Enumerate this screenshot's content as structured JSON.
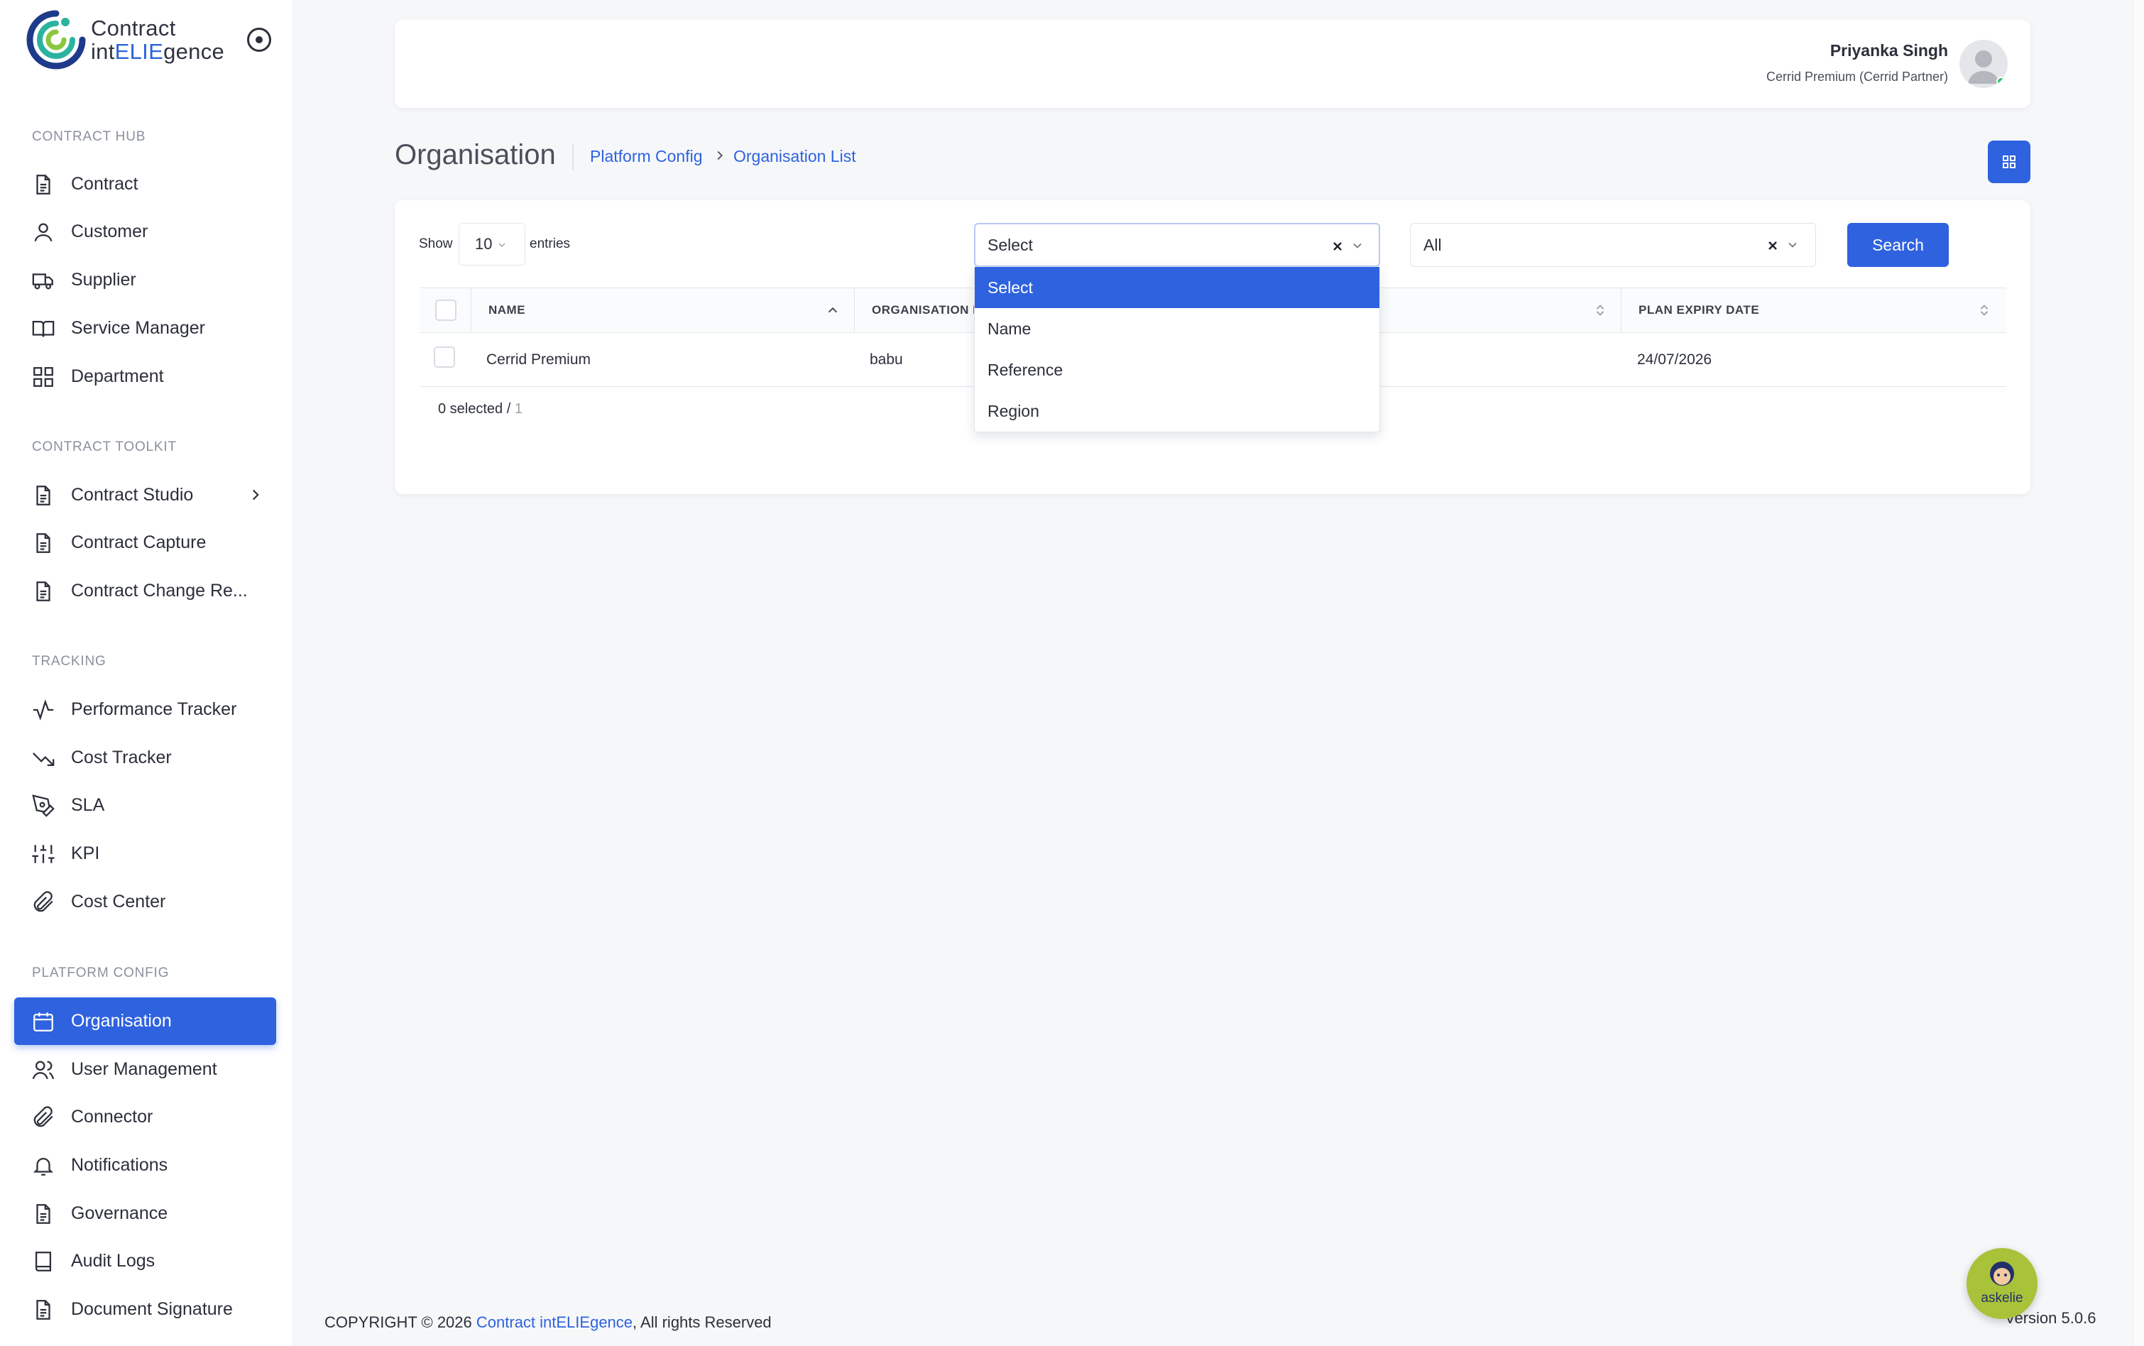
{
  "app": {
    "logo_line1": "Contract",
    "logo_line2_a": "int",
    "logo_line2_b": "ELIE",
    "logo_line2_c": "gence"
  },
  "sidebar": {
    "sections": [
      {
        "title": "CONTRACT HUB",
        "items": [
          {
            "label": "Contract",
            "icon": "file-text-icon"
          },
          {
            "label": "Customer",
            "icon": "user-icon"
          },
          {
            "label": "Supplier",
            "icon": "truck-icon"
          },
          {
            "label": "Service Manager",
            "icon": "book-open-icon"
          },
          {
            "label": "Department",
            "icon": "grid-icon"
          }
        ]
      },
      {
        "title": "CONTRACT TOOLKIT",
        "items": [
          {
            "label": "Contract Studio",
            "icon": "file-text-icon",
            "has_submenu": true
          },
          {
            "label": "Contract Capture",
            "icon": "file-text-icon"
          },
          {
            "label": "Contract Change Re...",
            "icon": "file-text-icon"
          }
        ]
      },
      {
        "title": "TRACKING",
        "items": [
          {
            "label": "Performance Tracker",
            "icon": "activity-icon"
          },
          {
            "label": "Cost Tracker",
            "icon": "trending-down-icon"
          },
          {
            "label": "SLA",
            "icon": "pen-tool-icon"
          },
          {
            "label": "KPI",
            "icon": "sliders-icon"
          },
          {
            "label": "Cost Center",
            "icon": "paperclip-icon"
          }
        ]
      },
      {
        "title": "PLATFORM CONFIG",
        "items": [
          {
            "label": "Organisation",
            "icon": "calendar-icon",
            "active": true
          },
          {
            "label": "User Management",
            "icon": "users-icon"
          },
          {
            "label": "Connector",
            "icon": "paperclip-icon"
          },
          {
            "label": "Notifications",
            "icon": "bell-icon"
          },
          {
            "label": "Governance",
            "icon": "file-text-icon"
          },
          {
            "label": "Audit Logs",
            "icon": "book-icon"
          },
          {
            "label": "Document Signature",
            "icon": "file-text-icon"
          }
        ]
      }
    ]
  },
  "header": {
    "user_name": "Priyanka Singh",
    "user_role": "Cerrid Premium (Cerrid Partner)"
  },
  "page": {
    "title": "Organisation",
    "breadcrumb": [
      "Platform Config",
      "Organisation List"
    ]
  },
  "filters": {
    "show_label": "Show",
    "entries_value": "10",
    "entries_label": "entries",
    "field_select_value": "Select",
    "field_options": [
      "Select",
      "Name",
      "Reference",
      "Region"
    ],
    "field_selected_option": "Select",
    "status_select_value": "All",
    "search_label": "Search"
  },
  "table": {
    "columns": [
      "NAME",
      "ORGANISATION I",
      "",
      "PLAN EXPIRY DATE"
    ],
    "rows": [
      {
        "name": "Cerrid Premium",
        "organisation": "babu",
        "plan_expiry": "24/07/2026"
      }
    ],
    "selected_count": "0 selected / ",
    "total_count": "1"
  },
  "footer": {
    "copyright_prefix": "COPYRIGHT © 2026 ",
    "brand": "Contract intELIEgence",
    "copyright_suffix": ", All rights Reserved",
    "version": "Version 5.0.6",
    "assistant_label": "askelie"
  },
  "colors": {
    "accent": "#2e62df",
    "status_online": "#2ec26b",
    "assistant_bg": "#a8c23a"
  }
}
